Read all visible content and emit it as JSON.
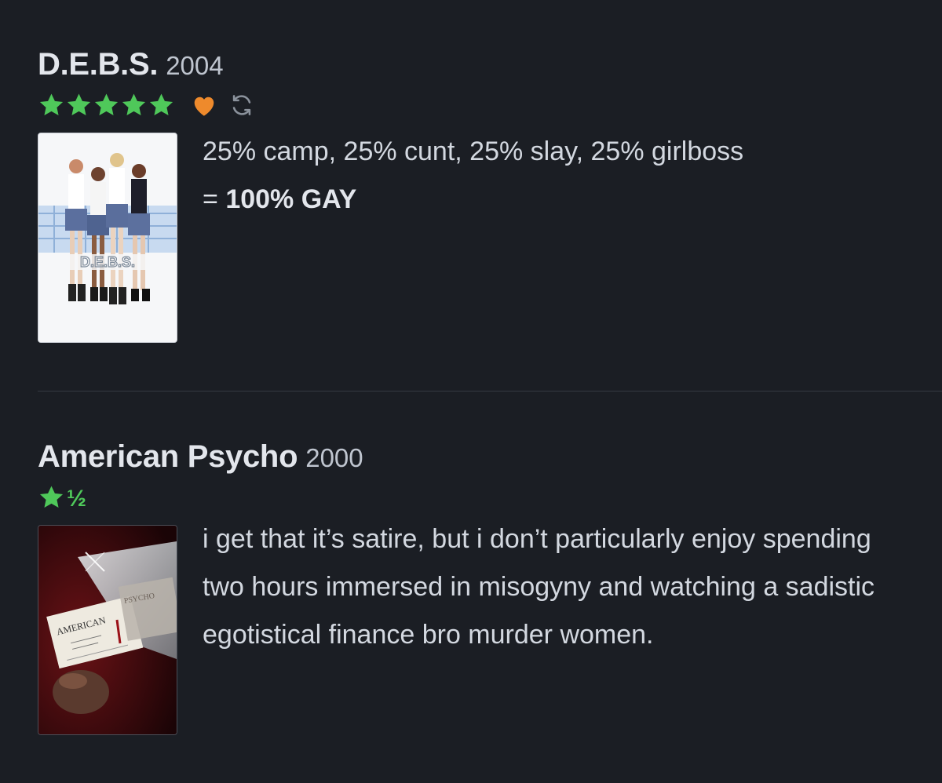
{
  "reviews": [
    {
      "title": "D.E.B.S.",
      "year": "2004",
      "rating": 5,
      "liked": true,
      "rewatch": true,
      "poster_text": "D.E.B.S.",
      "text_line1": "25% camp, 25% cunt, 25% slay, 25% girlboss",
      "text_eq": "= ",
      "text_bold": "100% GAY"
    },
    {
      "title": "American Psycho",
      "year": "2000",
      "rating": 1.5,
      "half_symbol": "½",
      "liked": false,
      "rewatch": false,
      "poster_text_1": "AMERICAN",
      "poster_text_2": "PSYCHO",
      "text": "i get that it’s satire, but i don’t particularly enjoy spending two hours immersed in misogyny and watching a sadistic egotistical finance bro murder women."
    }
  ],
  "colors": {
    "background": "#1b1e24",
    "star": "#4fc85a",
    "heart": "#ee8a2c",
    "rewatch": "#8b929c",
    "divider": "#343942"
  },
  "icons": [
    "star-icon",
    "heart-icon",
    "rewatch-icon"
  ]
}
